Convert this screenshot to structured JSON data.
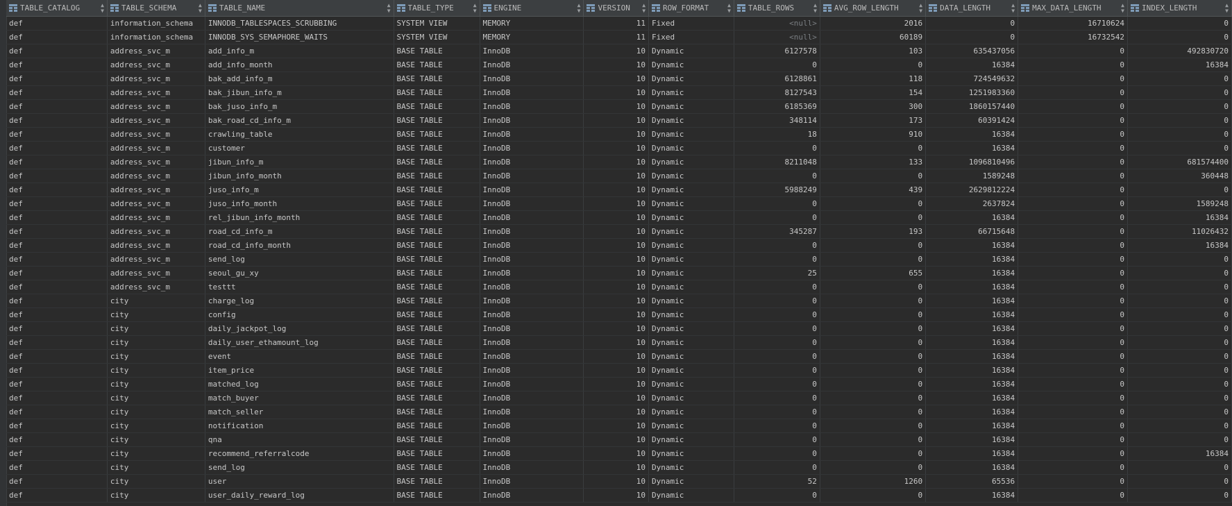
{
  "columns": [
    {
      "label": "TABLE_CATALOG",
      "align": "left"
    },
    {
      "label": "TABLE_SCHEMA",
      "align": "left"
    },
    {
      "label": "TABLE_NAME",
      "align": "left"
    },
    {
      "label": "TABLE_TYPE",
      "align": "left"
    },
    {
      "label": "ENGINE",
      "align": "left"
    },
    {
      "label": "VERSION",
      "align": "right"
    },
    {
      "label": "ROW_FORMAT",
      "align": "left"
    },
    {
      "label": "TABLE_ROWS",
      "align": "right"
    },
    {
      "label": "AVG_ROW_LENGTH",
      "align": "right"
    },
    {
      "label": "DATA_LENGTH",
      "align": "right"
    },
    {
      "label": "MAX_DATA_LENGTH",
      "align": "right"
    },
    {
      "label": "INDEX_LENGTH",
      "align": "right"
    }
  ],
  "null_text": "<null>",
  "rows": [
    [
      "def",
      "information_schema",
      "INNODB_TABLESPACES_SCRUBBING",
      "SYSTEM VIEW",
      "MEMORY",
      "11",
      "Fixed",
      "<null>",
      "2016",
      "0",
      "16710624",
      "0"
    ],
    [
      "def",
      "information_schema",
      "INNODB_SYS_SEMAPHORE_WAITS",
      "SYSTEM VIEW",
      "MEMORY",
      "11",
      "Fixed",
      "<null>",
      "60189",
      "0",
      "16732542",
      "0"
    ],
    [
      "def",
      "address_svc_m",
      "add_info_m",
      "BASE TABLE",
      "InnoDB",
      "10",
      "Dynamic",
      "6127578",
      "103",
      "635437056",
      "0",
      "492830720"
    ],
    [
      "def",
      "address_svc_m",
      "add_info_month",
      "BASE TABLE",
      "InnoDB",
      "10",
      "Dynamic",
      "0",
      "0",
      "16384",
      "0",
      "16384"
    ],
    [
      "def",
      "address_svc_m",
      "bak_add_info_m",
      "BASE TABLE",
      "InnoDB",
      "10",
      "Dynamic",
      "6128861",
      "118",
      "724549632",
      "0",
      "0"
    ],
    [
      "def",
      "address_svc_m",
      "bak_jibun_info_m",
      "BASE TABLE",
      "InnoDB",
      "10",
      "Dynamic",
      "8127543",
      "154",
      "1251983360",
      "0",
      "0"
    ],
    [
      "def",
      "address_svc_m",
      "bak_juso_info_m",
      "BASE TABLE",
      "InnoDB",
      "10",
      "Dynamic",
      "6185369",
      "300",
      "1860157440",
      "0",
      "0"
    ],
    [
      "def",
      "address_svc_m",
      "bak_road_cd_info_m",
      "BASE TABLE",
      "InnoDB",
      "10",
      "Dynamic",
      "348114",
      "173",
      "60391424",
      "0",
      "0"
    ],
    [
      "def",
      "address_svc_m",
      "crawling_table",
      "BASE TABLE",
      "InnoDB",
      "10",
      "Dynamic",
      "18",
      "910",
      "16384",
      "0",
      "0"
    ],
    [
      "def",
      "address_svc_m",
      "customer",
      "BASE TABLE",
      "InnoDB",
      "10",
      "Dynamic",
      "0",
      "0",
      "16384",
      "0",
      "0"
    ],
    [
      "def",
      "address_svc_m",
      "jibun_info_m",
      "BASE TABLE",
      "InnoDB",
      "10",
      "Dynamic",
      "8211048",
      "133",
      "1096810496",
      "0",
      "681574400"
    ],
    [
      "def",
      "address_svc_m",
      "jibun_info_month",
      "BASE TABLE",
      "InnoDB",
      "10",
      "Dynamic",
      "0",
      "0",
      "1589248",
      "0",
      "360448"
    ],
    [
      "def",
      "address_svc_m",
      "juso_info_m",
      "BASE TABLE",
      "InnoDB",
      "10",
      "Dynamic",
      "5988249",
      "439",
      "2629812224",
      "0",
      "0"
    ],
    [
      "def",
      "address_svc_m",
      "juso_info_month",
      "BASE TABLE",
      "InnoDB",
      "10",
      "Dynamic",
      "0",
      "0",
      "2637824",
      "0",
      "1589248"
    ],
    [
      "def",
      "address_svc_m",
      "rel_jibun_info_month",
      "BASE TABLE",
      "InnoDB",
      "10",
      "Dynamic",
      "0",
      "0",
      "16384",
      "0",
      "16384"
    ],
    [
      "def",
      "address_svc_m",
      "road_cd_info_m",
      "BASE TABLE",
      "InnoDB",
      "10",
      "Dynamic",
      "345287",
      "193",
      "66715648",
      "0",
      "11026432"
    ],
    [
      "def",
      "address_svc_m",
      "road_cd_info_month",
      "BASE TABLE",
      "InnoDB",
      "10",
      "Dynamic",
      "0",
      "0",
      "16384",
      "0",
      "16384"
    ],
    [
      "def",
      "address_svc_m",
      "send_log",
      "BASE TABLE",
      "InnoDB",
      "10",
      "Dynamic",
      "0",
      "0",
      "16384",
      "0",
      "0"
    ],
    [
      "def",
      "address_svc_m",
      "seoul_gu_xy",
      "BASE TABLE",
      "InnoDB",
      "10",
      "Dynamic",
      "25",
      "655",
      "16384",
      "0",
      "0"
    ],
    [
      "def",
      "address_svc_m",
      "testtt",
      "BASE TABLE",
      "InnoDB",
      "10",
      "Dynamic",
      "0",
      "0",
      "16384",
      "0",
      "0"
    ],
    [
      "def",
      "city",
      "charge_log",
      "BASE TABLE",
      "InnoDB",
      "10",
      "Dynamic",
      "0",
      "0",
      "16384",
      "0",
      "0"
    ],
    [
      "def",
      "city",
      "config",
      "BASE TABLE",
      "InnoDB",
      "10",
      "Dynamic",
      "0",
      "0",
      "16384",
      "0",
      "0"
    ],
    [
      "def",
      "city",
      "daily_jackpot_log",
      "BASE TABLE",
      "InnoDB",
      "10",
      "Dynamic",
      "0",
      "0",
      "16384",
      "0",
      "0"
    ],
    [
      "def",
      "city",
      "daily_user_ethamount_log",
      "BASE TABLE",
      "InnoDB",
      "10",
      "Dynamic",
      "0",
      "0",
      "16384",
      "0",
      "0"
    ],
    [
      "def",
      "city",
      "event",
      "BASE TABLE",
      "InnoDB",
      "10",
      "Dynamic",
      "0",
      "0",
      "16384",
      "0",
      "0"
    ],
    [
      "def",
      "city",
      "item_price",
      "BASE TABLE",
      "InnoDB",
      "10",
      "Dynamic",
      "0",
      "0",
      "16384",
      "0",
      "0"
    ],
    [
      "def",
      "city",
      "matched_log",
      "BASE TABLE",
      "InnoDB",
      "10",
      "Dynamic",
      "0",
      "0",
      "16384",
      "0",
      "0"
    ],
    [
      "def",
      "city",
      "match_buyer",
      "BASE TABLE",
      "InnoDB",
      "10",
      "Dynamic",
      "0",
      "0",
      "16384",
      "0",
      "0"
    ],
    [
      "def",
      "city",
      "match_seller",
      "BASE TABLE",
      "InnoDB",
      "10",
      "Dynamic",
      "0",
      "0",
      "16384",
      "0",
      "0"
    ],
    [
      "def",
      "city",
      "notification",
      "BASE TABLE",
      "InnoDB",
      "10",
      "Dynamic",
      "0",
      "0",
      "16384",
      "0",
      "0"
    ],
    [
      "def",
      "city",
      "qna",
      "BASE TABLE",
      "InnoDB",
      "10",
      "Dynamic",
      "0",
      "0",
      "16384",
      "0",
      "0"
    ],
    [
      "def",
      "city",
      "recommend_referralcode",
      "BASE TABLE",
      "InnoDB",
      "10",
      "Dynamic",
      "0",
      "0",
      "16384",
      "0",
      "16384"
    ],
    [
      "def",
      "city",
      "send_log",
      "BASE TABLE",
      "InnoDB",
      "10",
      "Dynamic",
      "0",
      "0",
      "16384",
      "0",
      "0"
    ],
    [
      "def",
      "city",
      "user",
      "BASE TABLE",
      "InnoDB",
      "10",
      "Dynamic",
      "52",
      "1260",
      "65536",
      "0",
      "0"
    ],
    [
      "def",
      "city",
      "user_daily_reward_log",
      "BASE TABLE",
      "InnoDB",
      "10",
      "Dynamic",
      "0",
      "0",
      "16384",
      "0",
      "0"
    ]
  ],
  "colors": {
    "background": "#2b2b2b",
    "header_bg": "#3c3f41",
    "text": "#c8c8c8",
    "null_text": "#7a7e82",
    "column_icon": "#7e9bb8"
  },
  "icons": {
    "column": "table-column-icon",
    "sort": "sort-toggle-icon"
  }
}
